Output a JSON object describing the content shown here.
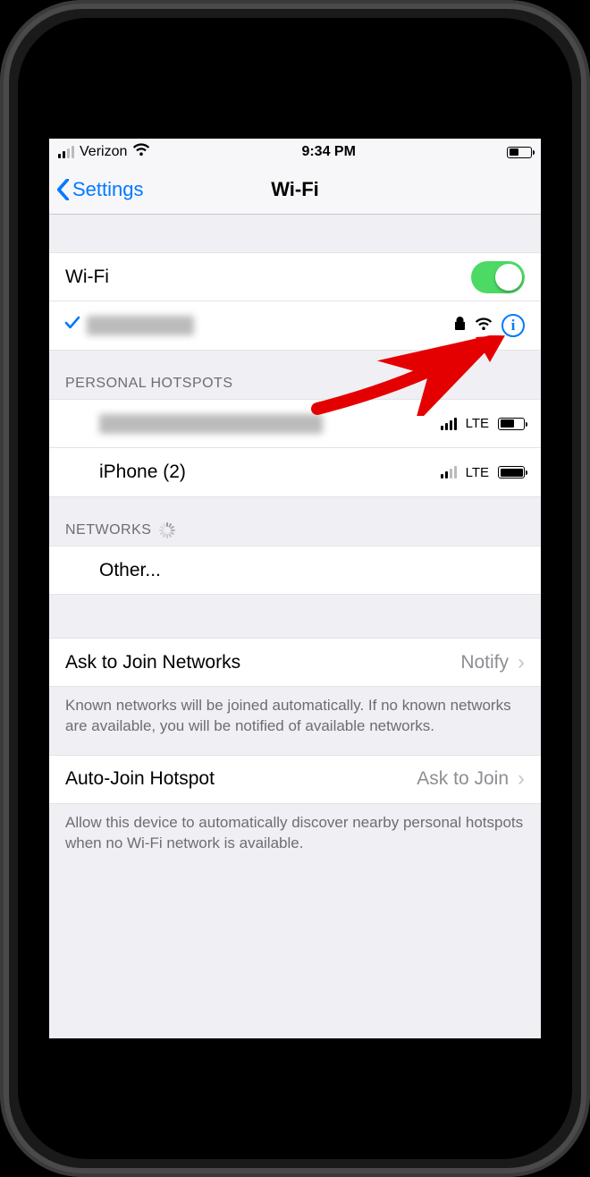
{
  "statusbar": {
    "carrier": "Verizon",
    "time": "9:34 PM"
  },
  "nav": {
    "back": "Settings",
    "title": "Wi-Fi"
  },
  "wifi_toggle_label": "Wi-Fi",
  "connected_network": "██████",
  "sections": {
    "hotspots_header": "PERSONAL HOTSPOTS",
    "networks_header": "NETWORKS"
  },
  "hotspots": [
    {
      "name": "████████████",
      "signal_full": 4,
      "conn": "LTE",
      "battery": 0.55,
      "blurred": true
    },
    {
      "name": "iPhone (2)",
      "signal_full": 2,
      "conn": "LTE",
      "battery": 0.95,
      "blurred": false
    }
  ],
  "other_label": "Other...",
  "ask_join": {
    "label": "Ask to Join Networks",
    "value": "Notify",
    "footer": "Known networks will be joined automatically. If no known networks are available, you will be notified of available networks."
  },
  "auto_join": {
    "label": "Auto-Join Hotspot",
    "value": "Ask to Join",
    "footer": "Allow this device to automatically discover nearby personal hotspots when no Wi-Fi network is available."
  }
}
